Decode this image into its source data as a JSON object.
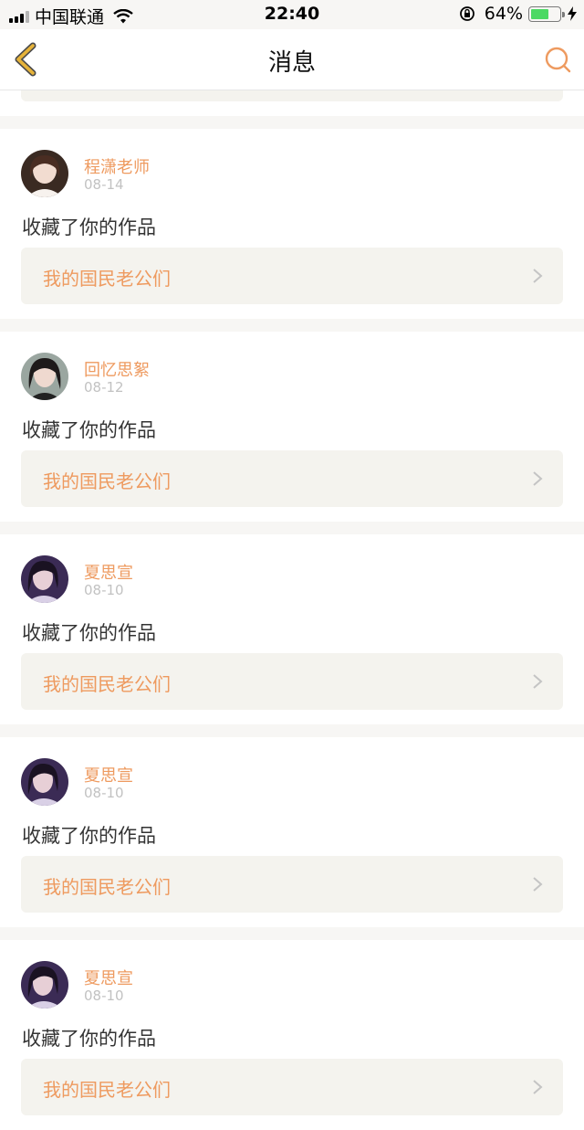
{
  "status_bar": {
    "carrier": "中国联通",
    "time": "22:40",
    "battery_percent": "64%",
    "battery_level": 0.64
  },
  "header": {
    "title": "消息",
    "back_icon": "chevron-left-icon",
    "search_icon": "search-icon"
  },
  "colors": {
    "accent": "#ee9a5f",
    "back_arrow": "#e6b33a",
    "box_bg": "#f4f3ee"
  },
  "messages": [
    {
      "name": "程潇老师",
      "date": "08-14",
      "action": "收藏了你的作品",
      "work": "我的国民老公们"
    },
    {
      "name": "回忆思絮",
      "date": "08-12",
      "action": "收藏了你的作品",
      "work": "我的国民老公们"
    },
    {
      "name": "夏思宣",
      "date": "08-10",
      "action": "收藏了你的作品",
      "work": "我的国民老公们"
    },
    {
      "name": "夏思宣",
      "date": "08-10",
      "action": "收藏了你的作品",
      "work": "我的国民老公们"
    },
    {
      "name": "夏思宣",
      "date": "08-10",
      "action": "收藏了你的作品",
      "work": "我的国民老公们"
    }
  ]
}
